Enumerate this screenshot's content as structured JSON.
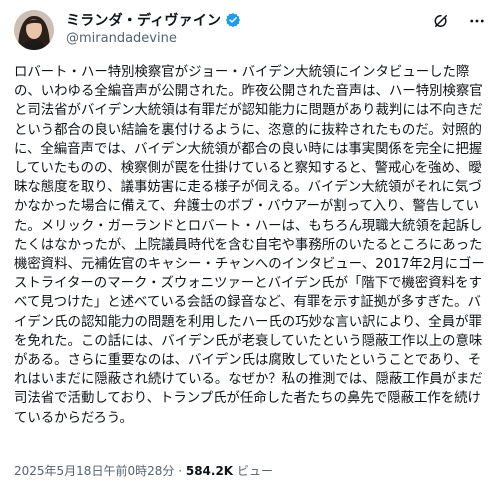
{
  "author": {
    "display_name": "ミランダ・ディヴァイン",
    "handle": "@mirandadevine",
    "verified_color": "#1d9bf0"
  },
  "header_icons": [
    "grok-icon",
    "more-icon"
  ],
  "post": {
    "text": "ロバート・ハー特別検察官がジョー・バイデン大統領にインタビューした際の、いわゆる全編音声が公開された。昨夜公開された音声は、ハー特別検察官と司法省がバイデン大統領は有罪だが認知能力に問題があり裁判には不向きだという都合の良い結論を裏付けるように、恣意的に抜粋されたものだ。対照的に、全編音声では、バイデン大統領が都合の良い時には事実関係を完全に把握していたものの、検察側が罠を仕掛けていると察知すると、警戒心を強め、曖昧な態度を取り、議事妨害に走る様子が伺える。バイデン大統領がそれに気づかなかった場合に備えて、弁護士のボブ・バウアーが割って入り、警告していた。メリック・ガーランドとロバート・ハーは、もちろん現職大統領を起訴したくはなかったが、上院議員時代を含む自宅や事務所のいたるところにあった機密資料、元補佐官のキャシー・チャンへのインタビュー、2017年2月にゴーストライターのマーク・ズウォニツァーとバイデン氏が「階下で機密資料をすべて見つけた」と述べている会話の録音など、有罪を示す証拠が多すぎた。バイデン氏の認知能力の問題を利用したハー氏の巧妙な言い訳により、全員が罪を免れた。この話には、バイデン氏が老衰していたという隠蔽工作以上の意味がある。さらに重要なのは、バイデン氏は腐敗していたということであり、それはいまだに隠蔽され続けている。なぜか？私の推測では、隠蔽工作員がまだ司法省で活動しており、トランプ氏が任命した者たちの鼻先で隠蔽工作を続けているからだろう。"
  },
  "meta": {
    "timestamp": "2025年5月18日午前0時28分",
    "separator": "·",
    "views_count": "584.2K",
    "views_label": "ビュー"
  }
}
